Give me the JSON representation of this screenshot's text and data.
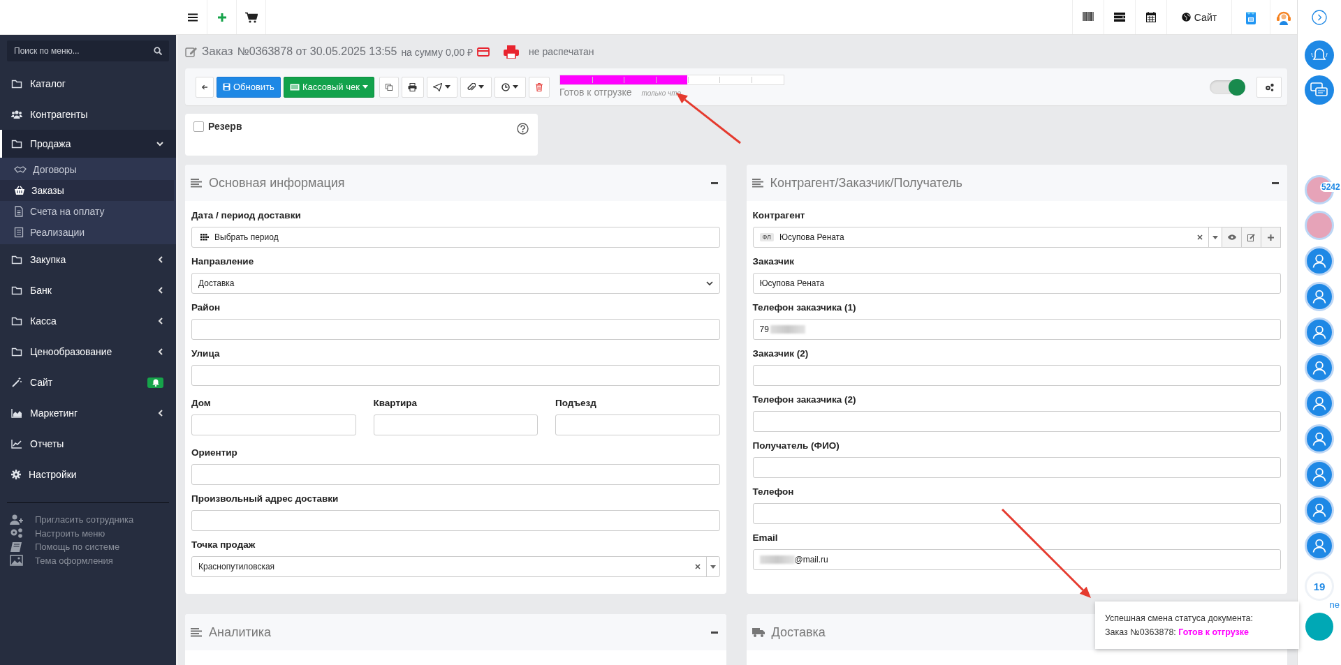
{
  "topbar": {
    "site_label": "Сайт"
  },
  "sidebar": {
    "search_placeholder": "Поиск по меню...",
    "items": [
      {
        "label": "Каталог",
        "kind": "link",
        "selected": false
      },
      {
        "label": "Контрагенты",
        "kind": "link",
        "selected": false
      },
      {
        "label": "Продажа",
        "kind": "group",
        "expanded": true,
        "selected": true,
        "children": [
          {
            "label": "Договоры",
            "selected": false
          },
          {
            "label": "Заказы",
            "selected": true
          },
          {
            "label": "Счета на оплату",
            "selected": false
          },
          {
            "label": "Реализации",
            "selected": false
          }
        ]
      },
      {
        "label": "Закупка",
        "kind": "group",
        "expanded": false,
        "selected": false
      },
      {
        "label": "Банк",
        "kind": "group",
        "expanded": false,
        "selected": false
      },
      {
        "label": "Касса",
        "kind": "group",
        "expanded": false,
        "selected": false
      },
      {
        "label": "Ценообразование",
        "kind": "group",
        "expanded": false,
        "selected": false
      },
      {
        "label": "Сайт",
        "kind": "badge",
        "selected": false
      },
      {
        "label": "Маркетинг",
        "kind": "group",
        "expanded": false,
        "selected": false
      },
      {
        "label": "Отчеты",
        "kind": "link",
        "selected": false
      },
      {
        "label": "Настройки",
        "kind": "link",
        "selected": false
      }
    ],
    "footer_links": [
      "Пригласить сотрудника",
      "Настроить меню",
      "Помощь по системе",
      "Тема оформления"
    ]
  },
  "title": {
    "heading": "Заказ",
    "number": "№0363878 от 30.05.2025 13:55",
    "sum": "на сумму 0,00 ₽",
    "print_status": "не распечатан"
  },
  "toolbar": {
    "buttons": [
      {
        "label": "Обновить",
        "kind": "primary"
      },
      {
        "label": "Кассовый чек",
        "kind": "success"
      }
    ],
    "status": {
      "level": 0.57,
      "label": "Готов к отгрузке",
      "time": "только что"
    },
    "toggle": {
      "on": true
    }
  },
  "reserve": {
    "label": "Резерв",
    "checked": false
  },
  "panels": [
    {
      "title": "Основная информация",
      "fields": [
        {
          "label": "Дата / период доставки",
          "kind": "period",
          "value": "Выбрать период"
        },
        {
          "label": "Направление",
          "kind": "select",
          "value": "Доставка"
        },
        {
          "label": "Район",
          "kind": "text"
        },
        {
          "label": "Улица",
          "kind": "text"
        },
        {
          "kind": "row",
          "fields": [
            {
              "label": "Дом",
              "kind": "text"
            },
            {
              "label": "Квартира",
              "kind": "text"
            },
            {
              "label": "Подъезд",
              "kind": "text"
            }
          ]
        },
        {
          "label": "Ориентир",
          "kind": "text"
        },
        {
          "label": "Произвольный адрес доставки",
          "kind": "text"
        },
        {
          "label": "Точка продаж",
          "kind": "combo",
          "value": "Краснопутиловская"
        }
      ]
    },
    {
      "title": "Контрагент/Заказчик/Получатель",
      "fields": [
        {
          "label": "Контрагент",
          "kind": "lookup",
          "tag": "ФЛ",
          "value": "Юсупова Рената"
        },
        {
          "label": "Заказчик",
          "kind": "text",
          "value": "Юсупова Рената"
        },
        {
          "label": "Телефон заказчика (1)",
          "kind": "masked",
          "prefix": "79"
        },
        {
          "label": "Заказчик (2)",
          "kind": "text"
        },
        {
          "label": "Телефон заказчика (2)",
          "kind": "text"
        },
        {
          "label": "Получатель (ФИО)",
          "kind": "text"
        },
        {
          "label": "Телефон",
          "kind": "text"
        },
        {
          "label": "Email",
          "kind": "masked",
          "suffix": "@mail.ru"
        }
      ]
    }
  ],
  "bottom_panels": [
    {
      "title": "Аналитика",
      "kind": "list"
    },
    {
      "title": "Доставка",
      "kind": "truck"
    }
  ],
  "rail": {
    "avatar_badge": "5242",
    "counter": "19",
    "cut_text": "ne"
  },
  "toast": {
    "message": "Успешная смена статуса документа:",
    "doc": "Заказ №0363878:",
    "status": "Готов к отгрузке"
  }
}
